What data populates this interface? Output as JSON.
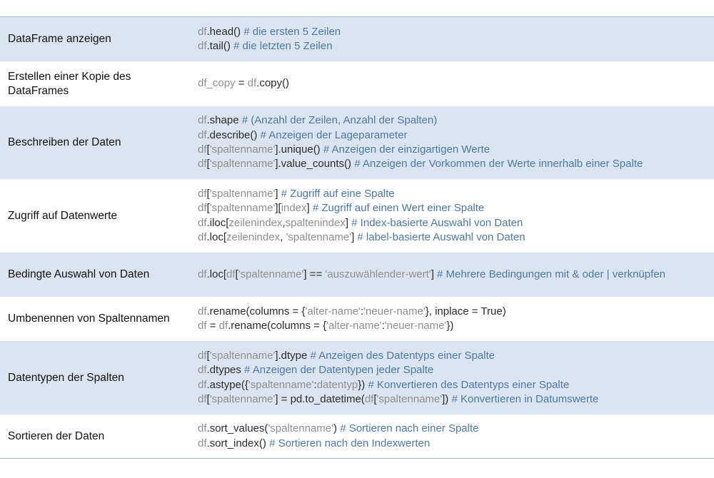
{
  "rows": [
    {
      "label": "DataFrame anzeigen",
      "lines": [
        [
          [
            "df",
            "df"
          ],
          [
            "op",
            ".head() "
          ],
          [
            "cm",
            "# die ersten 5 Zeilen"
          ]
        ],
        [
          [
            "df",
            "df"
          ],
          [
            "op",
            ".tail() "
          ],
          [
            "cm",
            "# die letzten 5 Zeilen"
          ]
        ]
      ]
    },
    {
      "label": "Erstellen einer Kopie des DataFrames",
      "lines": [
        [
          [
            "df",
            "df_copy"
          ],
          [
            "op",
            " = "
          ],
          [
            "df",
            "df"
          ],
          [
            "op",
            ".copy()"
          ]
        ]
      ]
    },
    {
      "label": "Beschreiben der Daten",
      "lines": [
        [
          [
            "df",
            "df"
          ],
          [
            "op",
            ".shape "
          ],
          [
            "cm",
            "# (Anzahl der Zeilen, Anzahl der Spalten)"
          ]
        ],
        [
          [
            "df",
            "df"
          ],
          [
            "op",
            ".describe() "
          ],
          [
            "cm",
            "# Anzeigen der Lageparameter"
          ]
        ],
        [
          [
            "df",
            "df"
          ],
          [
            "op",
            "["
          ],
          [
            "str",
            "'spaltenname'"
          ],
          [
            "op",
            "].unique() "
          ],
          [
            "cm",
            "# Anzeigen der einzigartigen Werte"
          ]
        ],
        [
          [
            "df",
            "df"
          ],
          [
            "op",
            "["
          ],
          [
            "str",
            "'spaltenname'"
          ],
          [
            "op",
            "].value_counts() "
          ],
          [
            "cm",
            "# Anzeigen der Vorkommen der Werte innerhalb einer Spalte"
          ]
        ]
      ]
    },
    {
      "label": "Zugriff auf Datenwerte",
      "lines": [
        [
          [
            "df",
            "df"
          ],
          [
            "op",
            "["
          ],
          [
            "str",
            "'spaltenname'"
          ],
          [
            "op",
            "] "
          ],
          [
            "cm",
            "# Zugriff auf eine Spalte"
          ]
        ],
        [
          [
            "df",
            "df"
          ],
          [
            "op",
            "["
          ],
          [
            "str",
            "'spaltenname'"
          ],
          [
            "op",
            "]["
          ],
          [
            "str",
            "index"
          ],
          [
            "op",
            "] "
          ],
          [
            "cm",
            "# Zugriff auf einen Wert einer Spalte"
          ]
        ],
        [
          [
            "df",
            "df"
          ],
          [
            "op",
            ".iloc["
          ],
          [
            "str",
            "zeilenindex"
          ],
          [
            "op",
            ","
          ],
          [
            "str",
            "spaltenindex"
          ],
          [
            "op",
            "] "
          ],
          [
            "cm",
            "# Index-basierte Auswahl von Daten"
          ]
        ],
        [
          [
            "df",
            "df"
          ],
          [
            "op",
            ".loc["
          ],
          [
            "str",
            "zeilenindex"
          ],
          [
            "op",
            ", "
          ],
          [
            "str",
            "'spaltenname'"
          ],
          [
            "op",
            "] "
          ],
          [
            "cm",
            "# label-basierte Auswahl von Daten"
          ]
        ]
      ]
    },
    {
      "label": "Bedingte Auswahl von Daten",
      "wrap": true,
      "lines": [
        [
          [
            "df",
            "df"
          ],
          [
            "op",
            ".loc["
          ],
          [
            "df",
            "df"
          ],
          [
            "op",
            "["
          ],
          [
            "str",
            "'spaltenname'"
          ],
          [
            "op",
            "] == "
          ],
          [
            "str",
            "'auszuwählender-wert'"
          ],
          [
            "op",
            "] "
          ],
          [
            "cm",
            "# Mehrere Bedingungen mit & oder | verknüpfen"
          ]
        ]
      ]
    },
    {
      "label": "Umbenennen von Spaltennamen",
      "lines": [
        [
          [
            "df",
            "df"
          ],
          [
            "op",
            ".rename(columns = {"
          ],
          [
            "str",
            "'alter-name'"
          ],
          [
            "op",
            ":"
          ],
          [
            "str",
            "'neuer-name'"
          ],
          [
            "op",
            "}, inplace = True)"
          ]
        ],
        [
          [
            "df",
            "df"
          ],
          [
            "op",
            " = "
          ],
          [
            "df",
            "df"
          ],
          [
            "op",
            ".rename(columns = {"
          ],
          [
            "str",
            "'alter-name'"
          ],
          [
            "op",
            ":"
          ],
          [
            "str",
            "'neuer-name'"
          ],
          [
            "op",
            "})"
          ]
        ]
      ]
    },
    {
      "label": "Datentypen der Spalten",
      "lines": [
        [
          [
            "df",
            "df"
          ],
          [
            "op",
            "["
          ],
          [
            "str",
            "'spaltenname'"
          ],
          [
            "op",
            "].dtype "
          ],
          [
            "cm",
            "# Anzeigen des Datentyps einer Spalte"
          ]
        ],
        [
          [
            "df",
            "df"
          ],
          [
            "op",
            ".dtypes "
          ],
          [
            "cm",
            "# Anzeigen der Datentypen jeder Spalte"
          ]
        ],
        [
          [
            "df",
            "df"
          ],
          [
            "op",
            ".astype({"
          ],
          [
            "str",
            "'spaltenname'"
          ],
          [
            "op",
            ":"
          ],
          [
            "str",
            "datentyp"
          ],
          [
            "op",
            "}) "
          ],
          [
            "cm",
            "# Konvertieren des Datentyps einer Spalte"
          ]
        ],
        [
          [
            "df",
            "df"
          ],
          [
            "op",
            "["
          ],
          [
            "str",
            "'spaltenname'"
          ],
          [
            "op",
            "] = pd.to_datetime("
          ],
          [
            "df",
            "df"
          ],
          [
            "op",
            "["
          ],
          [
            "str",
            "'spaltenname'"
          ],
          [
            "op",
            "]) "
          ],
          [
            "cm",
            "# Konvertieren in Datumswerte"
          ]
        ]
      ]
    },
    {
      "label": "Sortieren der Daten",
      "lines": [
        [
          [
            "df",
            "df"
          ],
          [
            "op",
            ".sort_values("
          ],
          [
            "str",
            "'spaltenname'"
          ],
          [
            "op",
            ") "
          ],
          [
            "cm",
            "# Sortieren nach einer Spalte"
          ]
        ],
        [
          [
            "df",
            "df"
          ],
          [
            "op",
            ".sort_index() "
          ],
          [
            "cm",
            "# Sortieren nach den Indexwerten"
          ]
        ]
      ]
    }
  ]
}
